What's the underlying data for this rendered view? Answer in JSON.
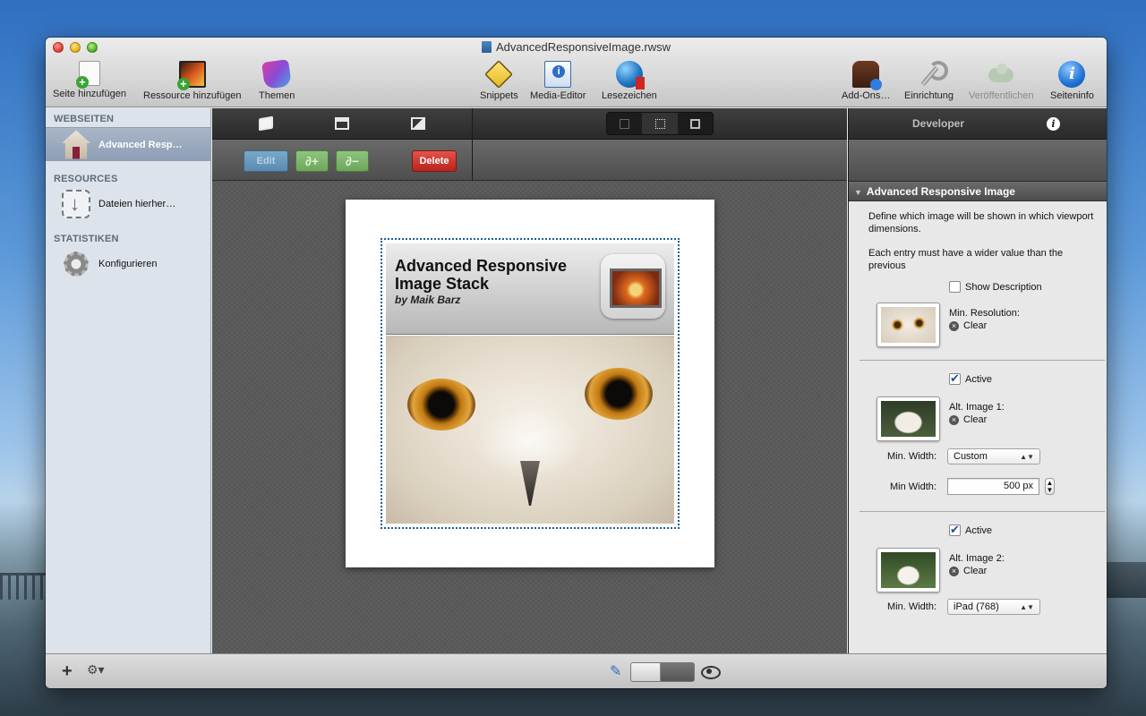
{
  "window": {
    "title": "AdvancedResponsiveImage.rwsw"
  },
  "toolbar": {
    "left": [
      {
        "label": "Seite hinzufügen",
        "icon": "add-page-icon"
      },
      {
        "label": "Ressource hinzufügen",
        "icon": "add-resource-icon"
      },
      {
        "label": "Themen",
        "icon": "themes-icon"
      }
    ],
    "center": [
      {
        "label": "Snippets",
        "icon": "snippets-icon"
      },
      {
        "label": "Media-Editor",
        "icon": "media-editor-icon"
      },
      {
        "label": "Lesezeichen",
        "icon": "bookmarks-icon"
      }
    ],
    "right": [
      {
        "label": "Add-Ons…",
        "icon": "addons-icon"
      },
      {
        "label": "Einrichtung",
        "icon": "wrench-icon"
      },
      {
        "label": "Veröffentlichen",
        "icon": "publish-cloud-icon",
        "disabled": true
      },
      {
        "label": "Seiteninfo",
        "icon": "info-icon"
      }
    ]
  },
  "sidebar": {
    "sections": [
      {
        "heading": "WEBSEITEN",
        "item": "Advanced Resp…",
        "icon": "house-icon",
        "selected": true
      },
      {
        "heading": "RESOURCES",
        "item": "Dateien hierher…",
        "icon": "download-icon"
      },
      {
        "heading": "STATISTIKEN",
        "item": "Konfigurieren",
        "icon": "gear-icon"
      }
    ]
  },
  "actions": {
    "edit": "Edit",
    "link_icon": "link-add-icon",
    "unlink_icon": "link-remove-icon",
    "delete": "Delete",
    "link_glyph": "∂+",
    "unlink_glyph": "∂−"
  },
  "stack": {
    "title": "Advanced Responsive Image Stack",
    "author": "by Maik Barz"
  },
  "inspector": {
    "tab_title": "Developer",
    "info_glyph": "i",
    "section": "Advanced Responsive Image",
    "desc1": "Define which image will be shown in which viewport dimensions.",
    "desc2": "Each entry must have a wider value than the previous",
    "show_description": "Show Description",
    "min_resolution": "Min. Resolution:",
    "clear": "Clear",
    "active": "Active",
    "alt1": "Alt. Image 1:",
    "min_width_label": "Min. Width:",
    "min_width_select1": "Custom",
    "min_width_field_label": "Min Width:",
    "min_width_value": "500 px",
    "alt2": "Alt. Image 2:",
    "min_width_select2": "iPad (768)"
  },
  "bottombar": {
    "plus": "+",
    "gear": "⚙▾",
    "pencil": "✎"
  }
}
